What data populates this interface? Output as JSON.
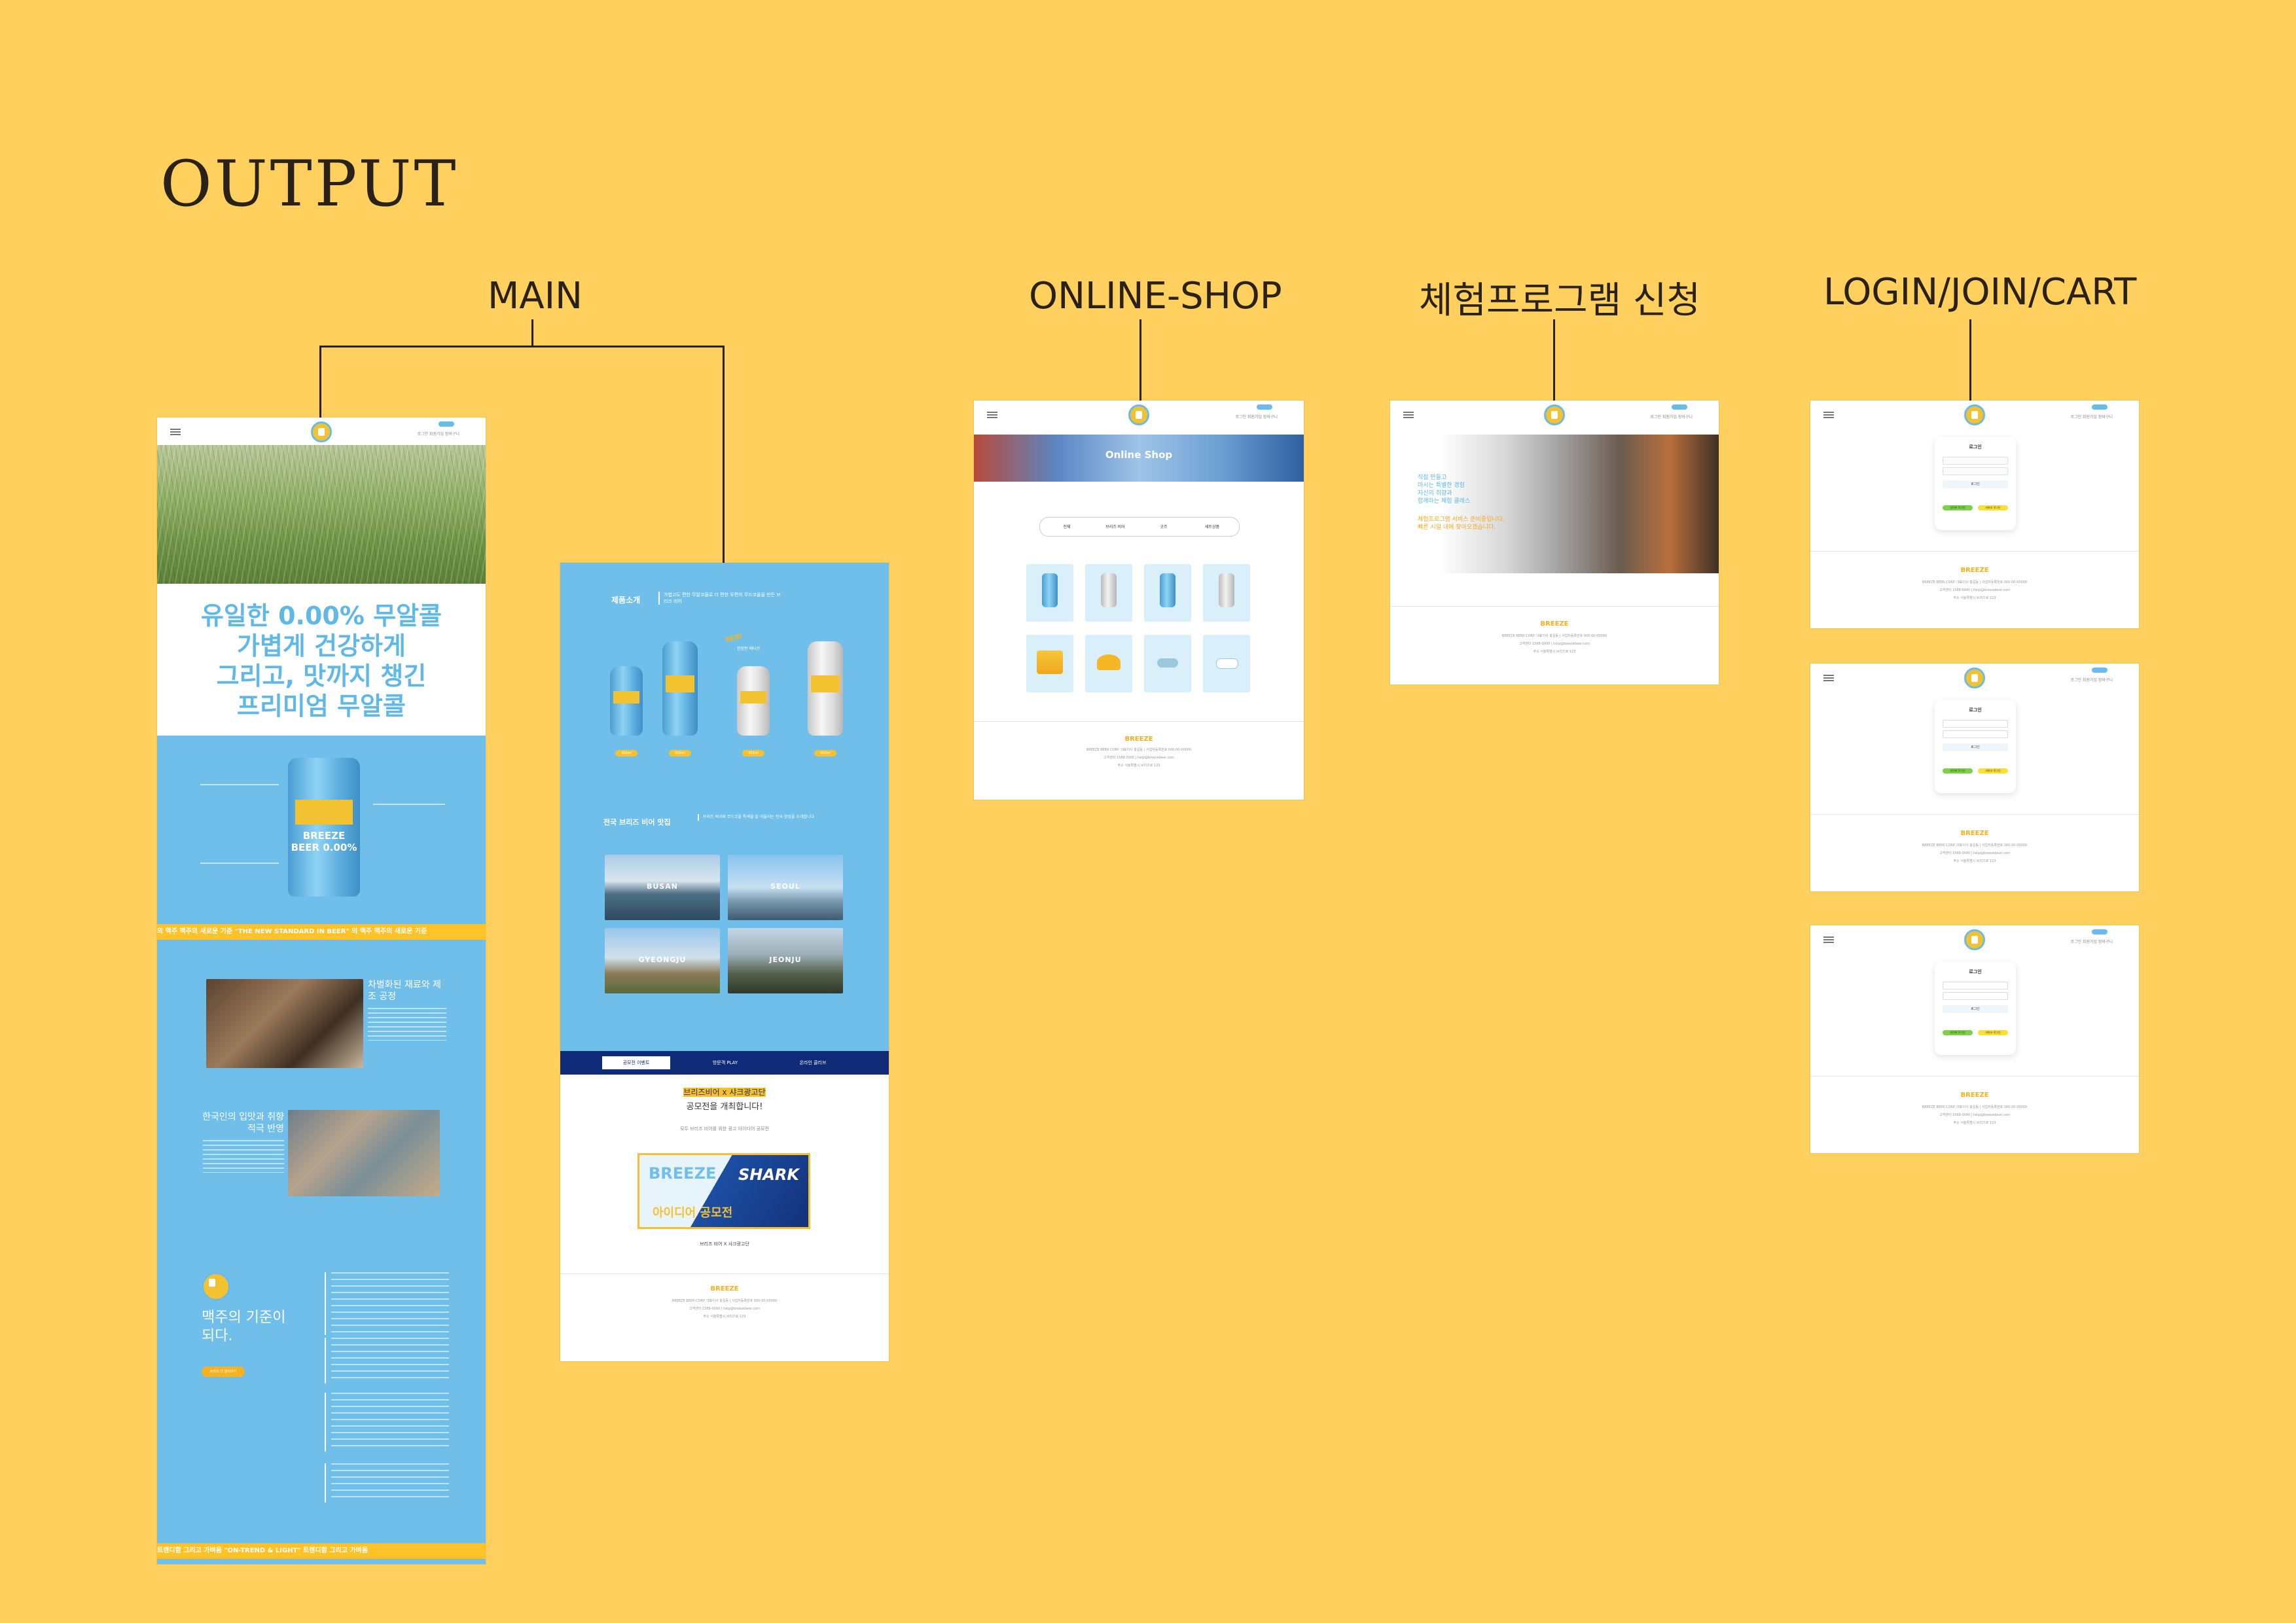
{
  "page": {
    "heading": "OUTPUT"
  },
  "sections": {
    "main": "MAIN",
    "shop": "ONLINE-SHOP",
    "experience": "체험프로그램 신청",
    "auth": "LOGIN/JOIN/CART"
  },
  "main_page": {
    "hero_lines": [
      "유일한 0.00% 무알콜",
      "가볍게 건강하게",
      "그리고, 맛까지 챙긴",
      "프리미엄 무알콜"
    ],
    "can_text": "BREEZE BEER 0.00%",
    "ticker1": "의 맥주 맥주의 새로운 기준      \"THE NEW STANDARD IN BEER\"      의 맥주 맥주의 새로운 기준",
    "factory_title": "차별화된 재료와 제조 공정",
    "taste_title": "한국인의 입맛과 취향 적극 반영",
    "standard_title": "맥주의 기준이 되다.",
    "standard_button": "브리즈 더 알아보기",
    "ticker2": "트렌디함 그리고 가벼움      \"ON-TREND & LIGHT\"      트렌디함 그리고 가벼움"
  },
  "main_page2": {
    "products_title": "제품소개",
    "products_desc": "가볍고도 편한 무알코올로 더 편한 우편의 무드코올을 만든 브리즈 비어",
    "new_badge": "NEW",
    "new_label": "한정판 에디션",
    "volumes": [
      "355ml",
      "500ml",
      "355ml",
      "500ml"
    ],
    "places_title": "전국 브리즈 비어 맛집",
    "places_desc": "브리즈 비어와 무드코올 특색을 잘 어울리는 전국 맛집을 소개합니다",
    "cities": [
      "BUSAN",
      "SEOUL",
      "GYEONGJU",
      "JEONJU"
    ],
    "tabs": [
      "공모전 이벤트",
      "방문객 PLAY",
      "온라인 클리브"
    ],
    "contest_title1": "브리즈비어 x 샤크광고단",
    "contest_title2": "공모전을 개최합니다!",
    "contest_sub": "모두 브리즈 비어를 위한 광고 아이디어 공모전",
    "contest_banner_left": "BREEZE",
    "contest_banner_right": "SHARK",
    "contest_banner_bottom": "아이디어 공모전",
    "contest_caption": "브리즈 비어 X 샤크광고단"
  },
  "shop_page": {
    "banner": "Online Shop",
    "tabs": [
      "전체",
      "브리즈 비어",
      "굿즈",
      "세트상품"
    ]
  },
  "experience_page": {
    "copy_lines": [
      "직접 만들고",
      "마시는 특별한 경험",
      "자신의 취향과",
      "함께하는 체험 클래스"
    ],
    "highlight_lines": [
      "체험프로그램 서비스 준비중입니다.",
      "빠른 시일 내에 찾아오겠습니다."
    ]
  },
  "auth_page": {
    "title": "로그인",
    "login_button": "로그인",
    "social_green": "네이버 로그인",
    "social_yellow": "카카오 로그인"
  },
  "nav": {
    "links": "로그인  회원가입  장바구니",
    "pill": "CART"
  },
  "footer": {
    "logo": "BREEZE",
    "line1": "BREEZE BEER CORP.  대표이사 홍길동  |  사업자등록번호 000-00-00000",
    "line2": "고객센터 1588-0000  |  help@breezebeer.com",
    "line3": "주소 서울특별시 브리즈로 123"
  }
}
